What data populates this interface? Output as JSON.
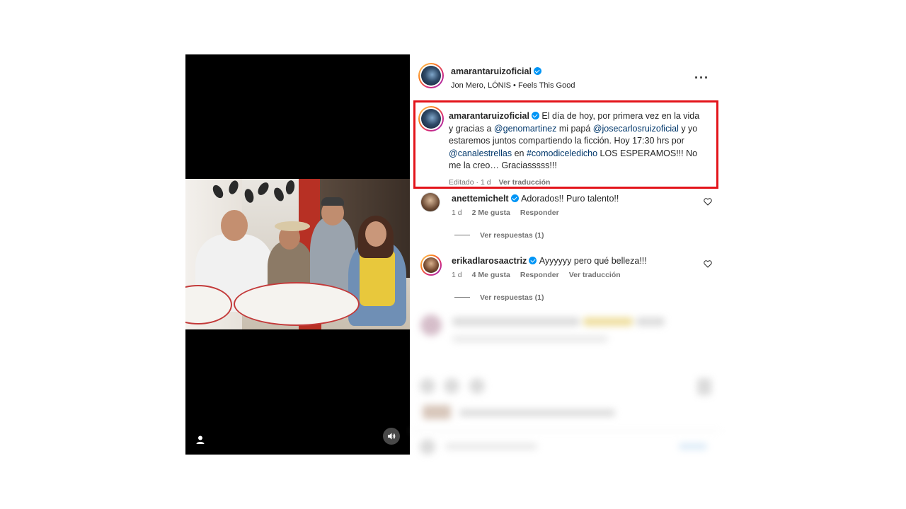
{
  "header": {
    "username": "amarantaruizoficial",
    "audio": "Jon Mero, LÓNIS • Feels This Good",
    "more_icon": "more-horizontal-icon"
  },
  "caption": {
    "username": "amarantaruizoficial",
    "t1": " El día de hoy, por primera vez en la vida y gracias a ",
    "m1": "@genomartinez",
    "t2": " mi papá ",
    "m2": "@josecarlosruizoficial",
    "t3": " y yo estaremos juntos compartiendo la ficción. Hoy 17:30 hrs por ",
    "m3": "@canalestrellas",
    "t4": " en ",
    "m4": "#comodiceledicho",
    "t5": " LOS ESPERAMOS!!! No me la creo… Graciasssss!!!",
    "edited": "Editado · 1 d",
    "translate": "Ver traducción",
    "highlight_color": "#e3141b"
  },
  "comments": [
    {
      "username": "anettemichelt",
      "text": "Adorados!! Puro talento!!",
      "time": "1 d",
      "likes": "2 Me gusta",
      "reply": "Responder",
      "translate": "",
      "replies": "Ver respuestas (1)"
    },
    {
      "username": "erikadlarosaactriz",
      "text": "Ayyyyyy pero qué belleza!!!",
      "time": "1 d",
      "likes": "4 Me gusta",
      "reply": "Responder",
      "translate": "Ver traducción",
      "replies": "Ver respuestas (1)"
    }
  ],
  "colors": {
    "verified": "#0095f6",
    "mention": "#00376b",
    "meta": "#737373"
  }
}
